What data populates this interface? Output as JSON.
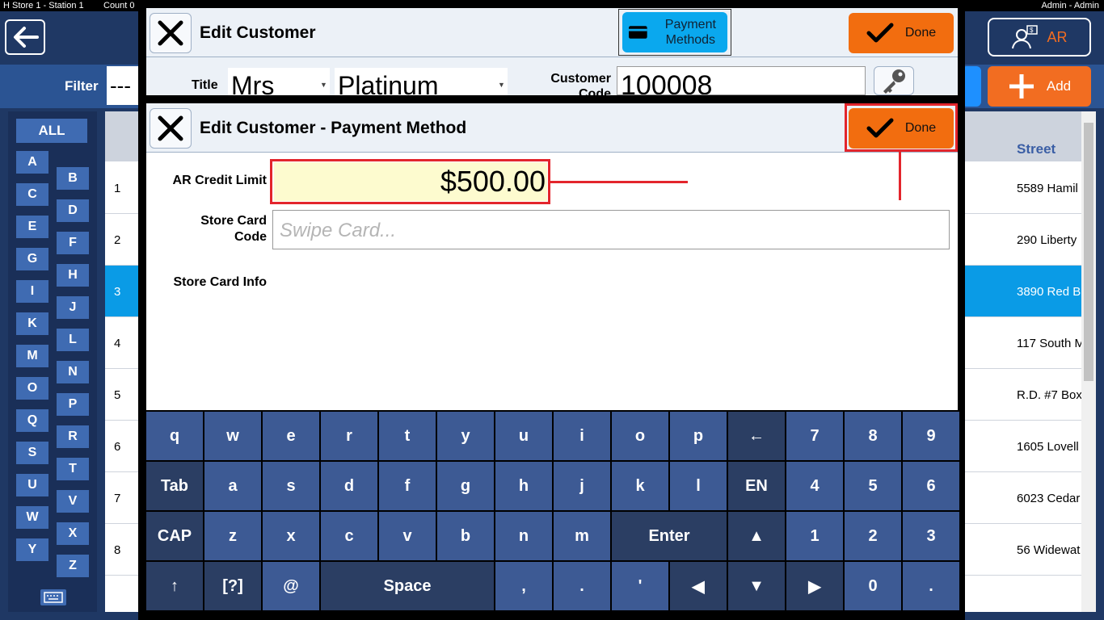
{
  "status_bar": {
    "left": "H   Store 1 - Station 1",
    "count": "Count 0",
    "right": "Admin - Admin"
  },
  "background": {
    "ar_label": "AR",
    "filter_label": "Filter",
    "filter_value": "---",
    "add_label": "Add",
    "alphabet": {
      "all": "ALL",
      "left_column": [
        "A",
        "C",
        "E",
        "G",
        "I",
        "K",
        "M",
        "O",
        "Q",
        "S",
        "U",
        "W",
        "Y"
      ],
      "right_column": [
        "B",
        "D",
        "F",
        "H",
        "J",
        "L",
        "N",
        "P",
        "R",
        "T",
        "V",
        "X",
        "Z"
      ]
    },
    "table": {
      "street_header": "Street",
      "rows": [
        {
          "num": "1",
          "street": "5589 Hamil"
        },
        {
          "num": "2",
          "street": "290 Liberty"
        },
        {
          "num": "3",
          "street": "3890 Red B"
        },
        {
          "num": "4",
          "street": "117 South M"
        },
        {
          "num": "5",
          "street": "R.D. #7 Box"
        },
        {
          "num": "6",
          "street": "1605 Lovell"
        },
        {
          "num": "7",
          "street": "6023 Cedar"
        },
        {
          "num": "8",
          "street": "56 Widewat"
        }
      ],
      "selected_row": 2
    }
  },
  "edit_customer": {
    "title": "Edit Customer",
    "payment_methods_label": "Payment Methods",
    "done_label": "Done",
    "title_field_label": "Title",
    "title_value": "Mrs",
    "tier_value": "Platinum",
    "customer_code_label": "Customer Code",
    "customer_code_value": "100008"
  },
  "payment_method": {
    "title": "Edit Customer - Payment Method",
    "done_label": "Done",
    "ar_credit_limit_label": "AR Credit Limit",
    "ar_credit_limit_value": "$500.00",
    "store_card_code_label": "Store Card Code",
    "store_card_code_placeholder": "Swipe Card...",
    "store_card_info_label": "Store Card Info"
  },
  "keyboard": {
    "row1": [
      "q",
      "w",
      "e",
      "r",
      "t",
      "y",
      "u",
      "i",
      "o",
      "p",
      "←",
      "7",
      "8",
      "9"
    ],
    "row2": [
      "Tab",
      "a",
      "s",
      "d",
      "f",
      "g",
      "h",
      "j",
      "k",
      "l",
      "EN",
      "4",
      "5",
      "6"
    ],
    "row3": [
      "CAP",
      "z",
      "x",
      "c",
      "v",
      "b",
      "n",
      "m",
      "Enter",
      "▲",
      "1",
      "2",
      "3"
    ],
    "row4": [
      "↑",
      "[?]",
      "@",
      "Space",
      ",",
      ".",
      "'",
      "◀",
      "▼",
      "▶",
      "0",
      "."
    ]
  },
  "colors": {
    "accent_orange": "#f26d0f",
    "accent_blue": "#0aa8ee",
    "annotation_red": "#e3252c",
    "key_blue": "#3d5a94"
  }
}
